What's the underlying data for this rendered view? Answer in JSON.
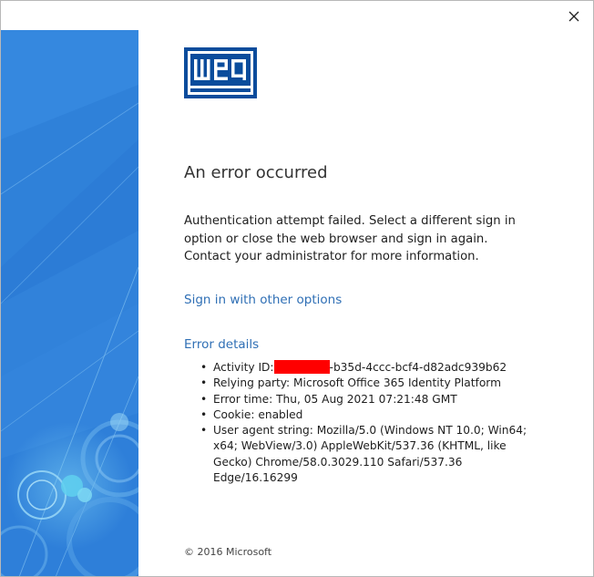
{
  "window": {
    "close_icon": "close-icon"
  },
  "brand": {
    "logo_text": "weg",
    "logo_color": "#0a4c9c"
  },
  "error": {
    "title": "An error occurred",
    "message": "Authentication attempt failed. Select a different sign in option or close the web browser and sign in again. Contact your administrator for more information."
  },
  "links": {
    "sign_in_other": "Sign in with other options",
    "error_details": "Error details"
  },
  "details": [
    {
      "label": "Activity ID:",
      "value": "-b35d-4ccc-bcf4-d82adc939b62",
      "redacted": true
    },
    {
      "text": "Relying party: Microsoft Office 365 Identity Platform"
    },
    {
      "text": "Error time: Thu, 05 Aug 2021 07:21:48 GMT"
    },
    {
      "text": "Cookie: enabled"
    },
    {
      "text": "User agent string: Mozilla/5.0 (Windows NT 10.0; Win64; x64; WebView/3.0) AppleWebKit/537.36 (KHTML, like Gecko) Chrome/58.0.3029.110 Safari/537.36 Edge/16.16299"
    }
  ],
  "footer": {
    "copyright": "© 2016 Microsoft"
  },
  "colors": {
    "link": "#2f6fb5",
    "side_panel": "#2f7fd8",
    "redaction": "#ff0000"
  }
}
